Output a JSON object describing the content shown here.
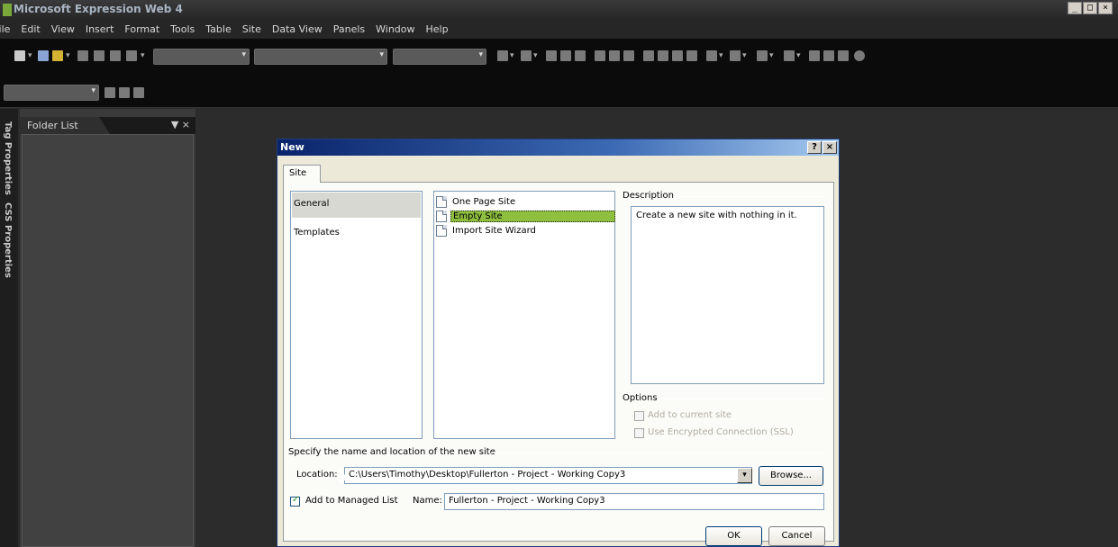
{
  "app": {
    "title": "Microsoft Expression Web 4",
    "window_buttons": [
      "_",
      "□",
      "×"
    ]
  },
  "menu": [
    "File",
    "Edit",
    "View",
    "Insert",
    "Format",
    "Tools",
    "Table",
    "Site",
    "Data View",
    "Panels",
    "Window",
    "Help"
  ],
  "side_tabs": [
    "Tag Properties",
    "CSS Properties"
  ],
  "folder_panel": {
    "title": "Folder List",
    "pin": "📌",
    "close": "×"
  },
  "dialog": {
    "title": "New",
    "help_button": "?",
    "close_button": "×",
    "tab": "Site",
    "categories": [
      {
        "label": "General",
        "selected": true
      },
      {
        "label": "Templates",
        "selected": false
      }
    ],
    "site_types": [
      {
        "label": "One Page Site",
        "selected": false
      },
      {
        "label": "Empty Site",
        "selected": true
      },
      {
        "label": "Import Site Wizard",
        "selected": false
      }
    ],
    "description_legend": "Description",
    "description_text": "Create a new site with nothing in it.",
    "options_legend": "Options",
    "options": [
      {
        "label": "Add to current site",
        "checked": false,
        "enabled": false
      },
      {
        "label": "Use Encrypted Connection (SSL)",
        "checked": false,
        "enabled": false
      }
    ],
    "specify_legend": "Specify the name and location of the new site",
    "location_label": "Location:",
    "location_value": "C:\\Users\\Timothy\\Desktop\\Fullerton - Project - Working Copy3",
    "browse_label": "Browse...",
    "managed_list_label": "Add to Managed List",
    "managed_list_checked": true,
    "name_label": "Name:",
    "name_value": "Fullerton - Project - Working Copy3",
    "ok_label": "OK",
    "cancel_label": "Cancel"
  }
}
